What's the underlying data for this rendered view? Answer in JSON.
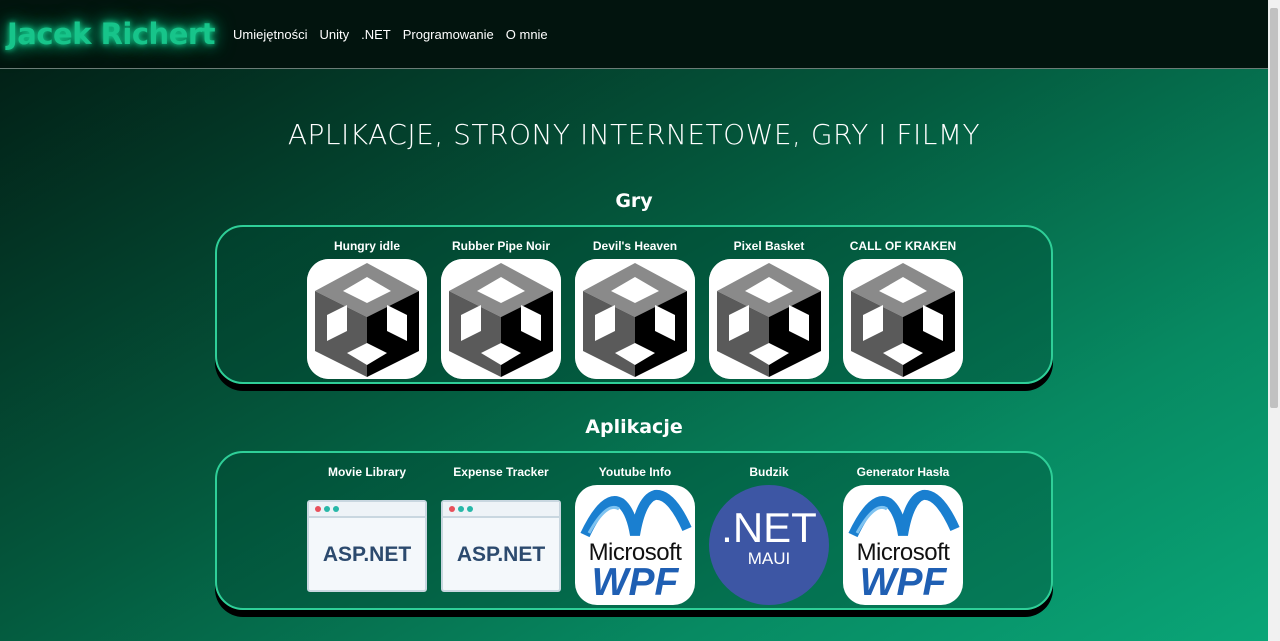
{
  "nav": {
    "brand": "Jacek Richert",
    "links": [
      "Umiejętności",
      "Unity",
      ".NET",
      "Programowanie",
      "O mnie"
    ]
  },
  "page_title": "APLIKACJE, STRONY INTERNETOWE, GRY I FILMY",
  "games": {
    "title": "Gry",
    "items": [
      {
        "label": "Hungry idle",
        "icon": "unity-icon"
      },
      {
        "label": "Rubber Pipe Noir",
        "icon": "unity-icon"
      },
      {
        "label": "Devil's Heaven",
        "icon": "unity-icon"
      },
      {
        "label": "Pixel Basket",
        "icon": "unity-icon"
      },
      {
        "label": "CALL OF KRAKEN",
        "icon": "unity-icon"
      }
    ]
  },
  "apps": {
    "title": "Aplikacje",
    "items": [
      {
        "label": "Movie Library",
        "icon": "aspnet-icon",
        "icon_text": "ASP.NET"
      },
      {
        "label": "Expense Tracker",
        "icon": "aspnet-icon",
        "icon_text": "ASP.NET"
      },
      {
        "label": "Youtube Info",
        "icon": "wpf-icon",
        "icon_text": "Microsoft",
        "icon_text2": "WPF"
      },
      {
        "label": "Budzik",
        "icon": "dotnet-maui-icon",
        "icon_text": ".NET",
        "icon_text2": "MAUI"
      },
      {
        "label": "Generator Hasła",
        "icon": "wpf-icon",
        "icon_text": "Microsoft",
        "icon_text2": "WPF"
      }
    ]
  },
  "colors": {
    "brand": "#17c48a",
    "panel_border": "#2fcf98",
    "maui_blue": "#3d56a4",
    "wpf_blue": "#1f5fb3"
  }
}
